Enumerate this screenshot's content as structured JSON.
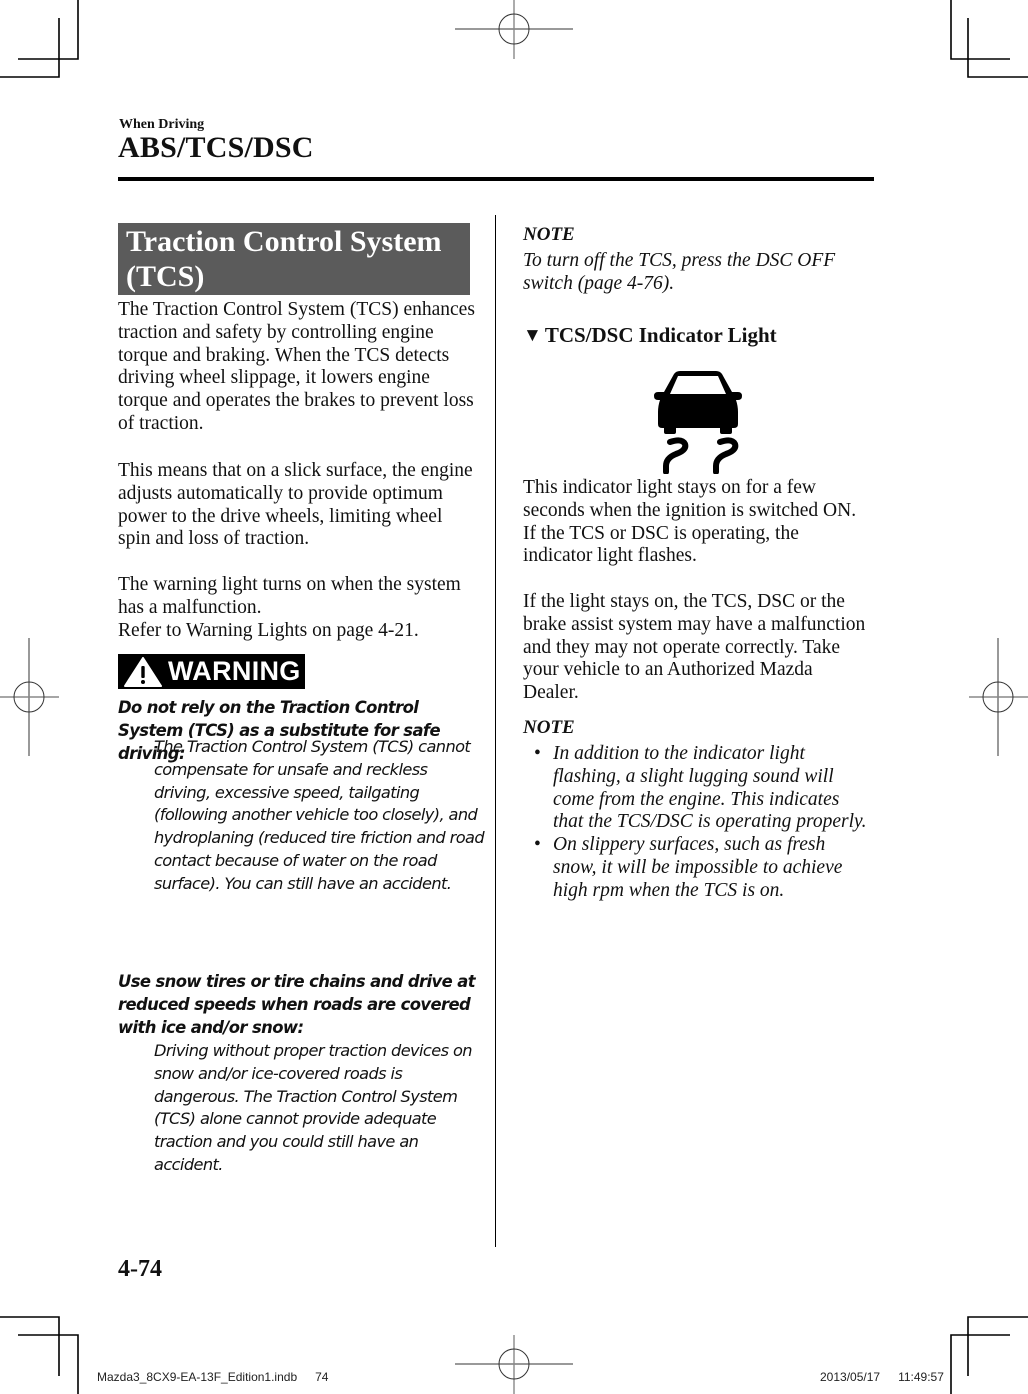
{
  "header": {
    "section": "When Driving",
    "title": "ABS/TCS/DSC"
  },
  "left_column": {
    "section_title": "Traction Control System (TCS)",
    "paragraphs": [
      "The Traction Control System (TCS) enhances traction and safety by controlling engine torque and braking. When the TCS detects driving wheel slippage, it lowers engine torque and operates the brakes to prevent loss of traction.",
      "This means that on a slick surface, the engine adjusts automatically to provide optimum power to the drive wheels, limiting wheel spin and loss of traction.",
      "The warning light turns on when the system has a malfunction.\nRefer to Warning Lights on page 4-21."
    ],
    "warning": {
      "icon": "warning-triangle-icon",
      "label": "WARNING",
      "items": [
        {
          "heading": "Do not rely on the Traction Control System (TCS) as a substitute for safe driving:",
          "body": "The Traction Control System (TCS) cannot compensate for unsafe and reckless driving, excessive speed, tailgating (following another vehicle too closely), and hydroplaning (reduced tire friction and road contact because of water on the road surface). You can still have an accident."
        },
        {
          "heading": "Use snow tires or tire chains and drive at reduced speeds when roads are covered with ice and/or snow:",
          "body": "Driving without proper traction devices on snow and/or ice-covered roads is dangerous. The Traction Control System (TCS) alone cannot provide adequate traction and you could still have an accident."
        }
      ]
    }
  },
  "right_column": {
    "note1": {
      "label": "NOTE",
      "text": "To turn off the TCS, press the DSC OFF switch (page 4-76)."
    },
    "subsection": {
      "marker": "▼",
      "title": "TCS/DSC Indicator Light",
      "icon": "tcs-dsc-indicator-icon"
    },
    "paragraphs": [
      "This indicator light stays on for a few seconds when the ignition is switched ON. If the TCS or DSC is operating, the indicator light flashes.",
      "If the light stays on, the TCS, DSC or the brake assist system may have a malfunction and they may not operate correctly. Take your vehicle to an Authorized Mazda Dealer."
    ],
    "note2": {
      "label": "NOTE",
      "bullet": "•",
      "items": [
        "In addition to the indicator light flashing, a slight lugging sound will come from the engine. This indicates that the TCS/DSC is operating properly.",
        "On slippery surfaces, such as fresh snow, it will be impossible to achieve high rpm when the TCS is on."
      ]
    }
  },
  "footer": {
    "page_number": "4-74",
    "slug_file": "Mazda3_8CX9-EA-13F_Edition1.indb",
    "slug_page": "74",
    "slug_date": "2013/05/17",
    "slug_time": "11:49:57"
  },
  "colors": {
    "banner_bg": "#5b5b5b",
    "warning_bg": "#000000",
    "text": "#111111"
  }
}
